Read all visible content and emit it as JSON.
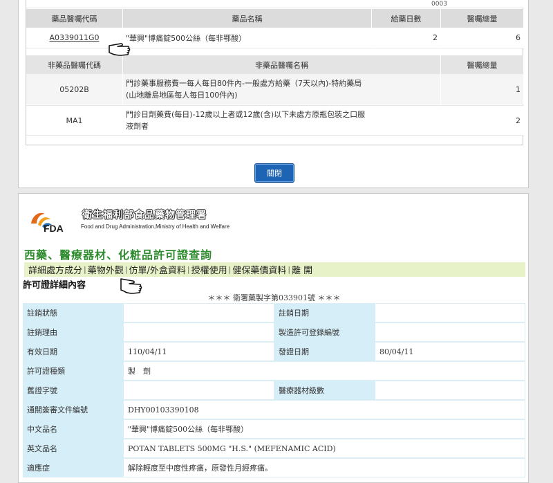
{
  "top_code": "0003",
  "drug_table": {
    "headers": [
      "藥品醫囑代碼",
      "藥品名稱",
      "給藥日數",
      "醫囑總量"
    ],
    "row": {
      "code": "A0339011G0",
      "name": "\"華興\"博痛錠500公絲（每非鄂酸）",
      "days": "2",
      "total": "6"
    }
  },
  "nondrug_table": {
    "headers": [
      "非藥品醫囑代碼",
      "非藥品醫囑名稱",
      "醫囑總量"
    ],
    "rows": [
      {
        "code": "05202B",
        "name_line1": "門診藥事服務費一每人每日80件內-一般處方給藥（7天以內)-特約藥局",
        "name_line2": "(山地離島地區每人每日100件內)",
        "total": "1"
      },
      {
        "code": "MA1",
        "name_line1": "門診日劑藥費(每日)-12歲以上者或12歲(含)以下未處方原瓶包裝之口服",
        "name_line2": "液劑者",
        "total": "2"
      }
    ]
  },
  "close_button": "關閉",
  "org": {
    "name_cn": "衛生福利部食品藥物管理署",
    "name_en": "Food and Drug Administration,Ministry of Health and Welfare",
    "logo_text": "FDA"
  },
  "page_heading": "西藥、醫療器材、化粧品許可證查詢",
  "nav": [
    "詳細處方成分",
    "藥物外觀",
    "仿單/外盒資料",
    "授權使用",
    "健保藥價資料",
    "離 開"
  ],
  "detail_title": "許可證詳細內容",
  "license_no": "＊＊＊ 衛署藥製字第033901號 ＊＊＊",
  "info": {
    "r1": {
      "l1": "註銷狀態",
      "v1": "",
      "l2": "註銷日期",
      "v2": ""
    },
    "r2": {
      "l1": "註銷理由",
      "v1": "",
      "l2": "製造許可登錄編號",
      "v2": ""
    },
    "r3": {
      "l1": "有效日期",
      "v1": "110/04/11",
      "l2": "發證日期",
      "v2": "80/04/11"
    },
    "r4": {
      "l1": "許可證種類",
      "v1": "製　劑"
    },
    "r5": {
      "l1": "舊證字號",
      "v1": "",
      "l2": "醫療器材級數",
      "v2": ""
    },
    "r6": {
      "l1": "通關簽審文件編號",
      "v1": "DHY00103390108"
    },
    "r7": {
      "l1": "中文品名",
      "v1": "\"華興\"博痛錠500公絲（每非鄂酸）"
    },
    "r8": {
      "l1": "英文品名",
      "v1": "POTAN TABLETS 500MG \"H.S.\" (MEFENAMIC ACID)"
    },
    "r9": {
      "l1": "適應症",
      "v1": "解除輕度至中度性疼痛，原發性月經疼痛。"
    }
  }
}
